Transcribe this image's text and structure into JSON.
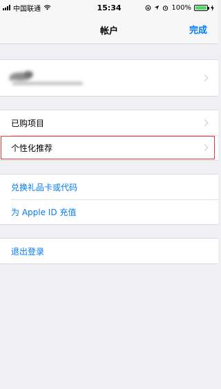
{
  "status_bar": {
    "carrier": "中国联通",
    "time": "15:34",
    "battery_percent": "100%"
  },
  "nav": {
    "title": "帐户",
    "done_label": "完成"
  },
  "menu": {
    "purchased": "已购项目",
    "personalized": "个性化推荐",
    "redeem": "兑换礼品卡或代码",
    "add_funds": "为 Apple ID 充值",
    "sign_out": "退出登录"
  },
  "colors": {
    "accent": "#007aff",
    "background": "#efeff4",
    "highlight_border": "#e53935",
    "battery": "#4cd964"
  }
}
